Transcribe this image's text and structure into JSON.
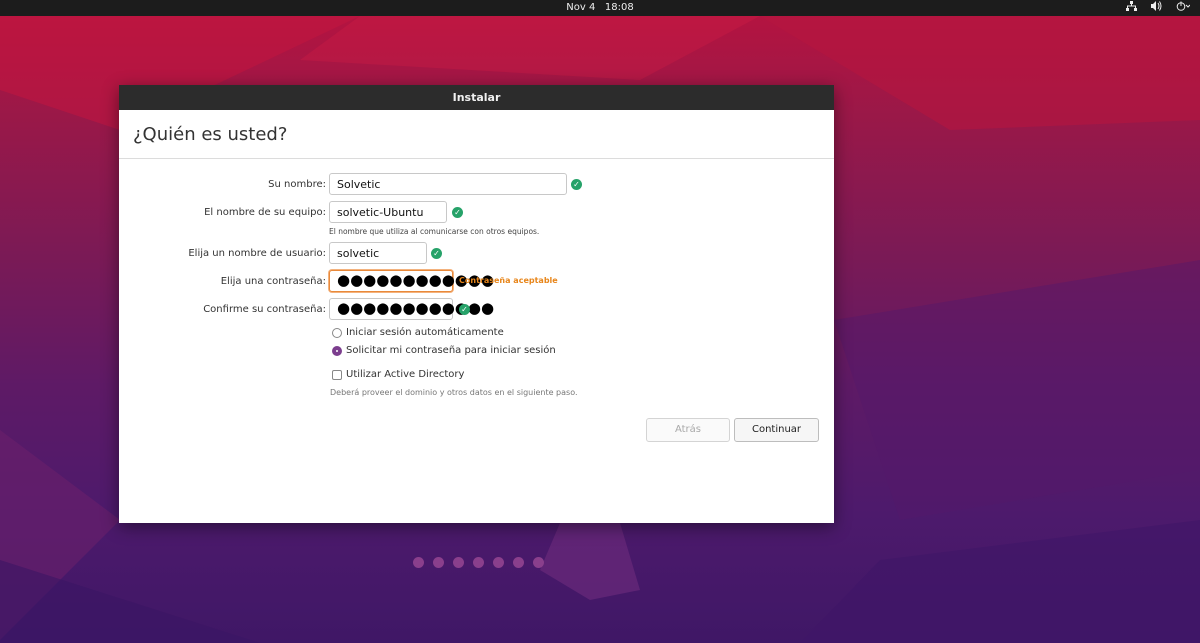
{
  "topbar": {
    "date": "Nov 4",
    "time": "18:08",
    "icons": [
      "network-icon",
      "volume-icon",
      "power-icon"
    ]
  },
  "window": {
    "title": "Instalar",
    "heading": "¿Quién es usted?"
  },
  "form": {
    "name_label": "Su nombre:",
    "name_value": "Solvetic",
    "computer_label": "El nombre de su equipo:",
    "computer_value": "solvetic-Ubuntu",
    "computer_hint": "El nombre que utiliza al comunicarse con otros equipos.",
    "username_label": "Elija un nombre de usuario:",
    "username_value": "solvetic",
    "password_label": "Elija una contraseña:",
    "password_value": "●●●●●●●●●●●●",
    "password_strength": "Contraseña aceptable",
    "confirm_label": "Confirme su contraseña:",
    "confirm_value": "●●●●●●●●●●●●",
    "login_options": [
      {
        "label": "Iniciar sesión automáticamente",
        "selected": false
      },
      {
        "label": "Solicitar mi contraseña para iniciar sesión",
        "selected": true
      }
    ],
    "active_directory_label": "Utilizar Active Directory",
    "active_directory_checked": false,
    "active_directory_note": "Deberá proveer el dominio y otros datos en el siguiente paso."
  },
  "buttons": {
    "back": "Atrás",
    "continue": "Continuar"
  },
  "progress": {
    "steps": 7
  },
  "colors": {
    "accent": "#7c3e8e",
    "valid": "#26a269",
    "warning": "#e8861b",
    "titlebar": "#2c2c2c"
  }
}
